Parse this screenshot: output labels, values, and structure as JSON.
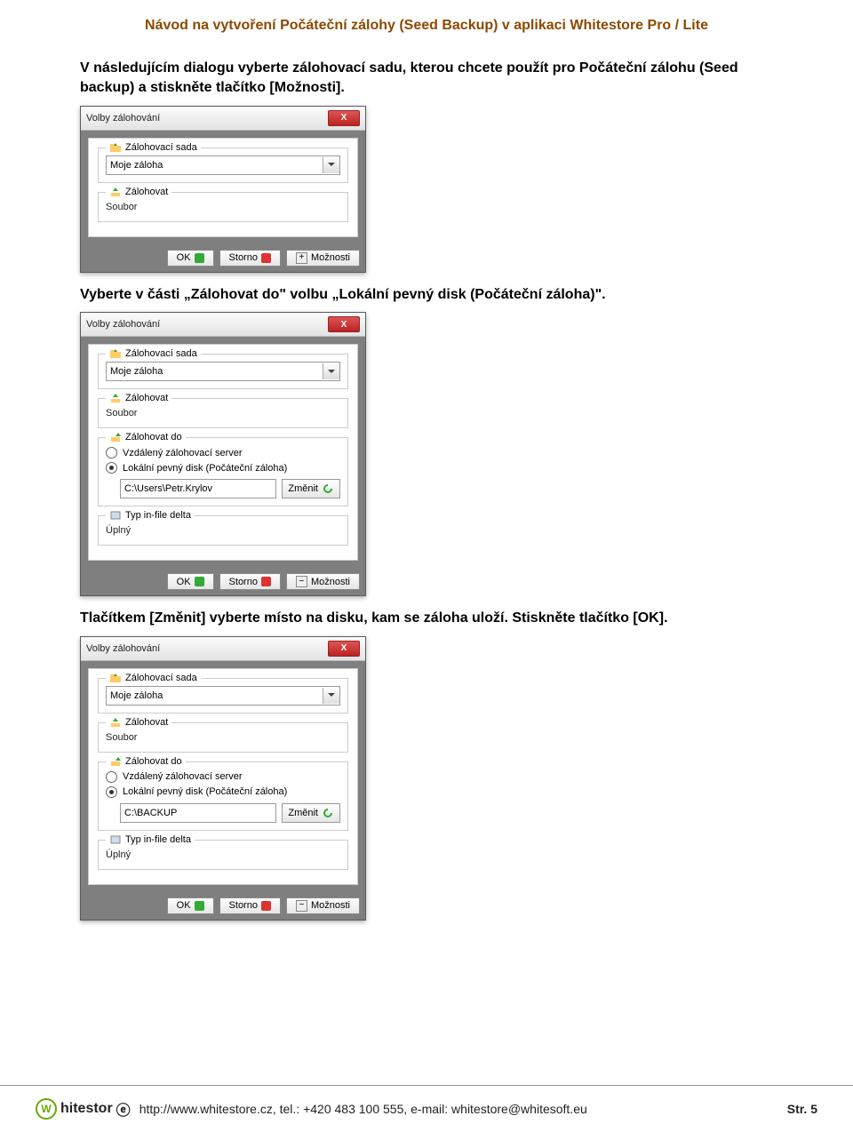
{
  "page": {
    "title": "Návod na vytvoření Počáteční zálohy (Seed Backup) v aplikaci Whitestore Pro / Lite",
    "para1": "V následujícím dialogu vyberte zálohovací sadu, kterou chcete použít pro Počáteční zálohu (Seed backup) a stiskněte tlačítko [Možnosti].",
    "para2": "Vyberte v části „Zálohovat do\" volbu „Lokální pevný disk (Počáteční záloha)\".",
    "para3": "Tlačítkem [Změnit] vyberte místo na disku, kam se záloha uloží. Stiskněte tlačítko [OK]."
  },
  "dialog": {
    "title": "Volby zálohování",
    "group_set": "Zálohovací sada",
    "combo_value": "Moje záloha",
    "group_backup": "Zálohovat",
    "backup_value": "Soubor",
    "group_dest": "Zálohovat do",
    "radio_remote": "Vzdálený zálohovací server",
    "radio_local": "Lokální pevný disk (Počáteční záloha)",
    "path1": "C:\\Users\\Petr.Krylov",
    "path2": "C:\\BACKUP",
    "change_btn": "Změnit",
    "group_delta": "Typ in-file delta",
    "delta_value": "Úplný",
    "btn_ok": "OK",
    "btn_cancel": "Storno",
    "btn_options": "Možnosti",
    "plus": "+",
    "minus": "−",
    "close": "X"
  },
  "footer": {
    "brand1": "hitestor",
    "info": "http://www.whitestore.cz, tel.: +420 483 100 555, e-mail: whitestore@whitesoft.eu",
    "page": "Str. 5"
  }
}
